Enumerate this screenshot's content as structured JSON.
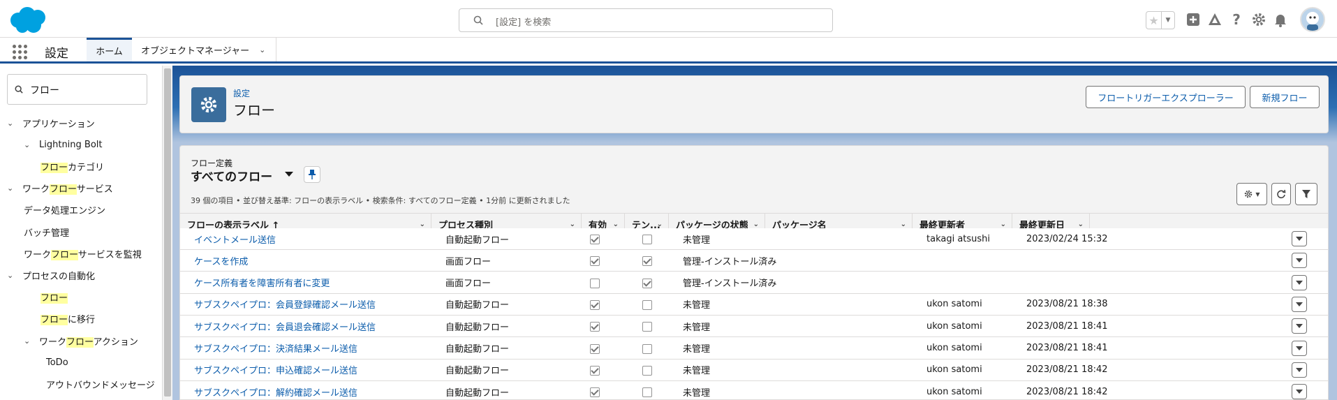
{
  "topbar": {
    "search_placeholder": "[設定] を検索",
    "brand_color": "#00a1e0"
  },
  "nav": {
    "app_name": "設定",
    "tabs": [
      {
        "label": "ホーム",
        "active": true
      },
      {
        "label": "オブジェクトマネージャー",
        "active": false
      }
    ]
  },
  "sidebar": {
    "search_value": "フロー",
    "tree": [
      {
        "pre": "アプリケーション",
        "hl": "",
        "post": "",
        "caret": true,
        "level": 0
      },
      {
        "pre": "Lightning Bolt",
        "hl": "",
        "post": "",
        "caret": true,
        "level": 1
      },
      {
        "pre": "",
        "hl": "フロー",
        "post": "カテゴリ",
        "caret": false,
        "level": 2
      },
      {
        "pre": "ワーク",
        "hl": "フロー",
        "post": "サービス",
        "caret": true,
        "level": 0
      },
      {
        "pre": "データ処理エンジン",
        "hl": "",
        "post": "",
        "caret": false,
        "level": 1
      },
      {
        "pre": "バッチ管理",
        "hl": "",
        "post": "",
        "caret": false,
        "level": 1
      },
      {
        "pre": "ワーク",
        "hl": "フロー",
        "post": "サービスを監視",
        "caret": false,
        "level": 1
      },
      {
        "pre": "プロセスの自動化",
        "hl": "",
        "post": "",
        "caret": true,
        "level": 0
      },
      {
        "pre": "",
        "hl": "フロー",
        "post": "",
        "caret": false,
        "level": 2
      },
      {
        "pre": "",
        "hl": "フロー",
        "post": "に移行",
        "caret": false,
        "level": 2
      },
      {
        "pre": "ワーク",
        "hl": "フロー",
        "post": "アクション",
        "caret": true,
        "level": 1
      },
      {
        "pre": "ToDo",
        "hl": "",
        "post": "",
        "caret": false,
        "level": 3
      },
      {
        "pre": "アウトバウンドメッセージ",
        "hl": "",
        "post": "",
        "caret": false,
        "level": 3
      }
    ]
  },
  "header": {
    "breadcrumb": "設定",
    "title": "フロー",
    "btn_trigger_explorer": "フロートリガーエクスプローラー",
    "btn_new_flow": "新規フロー"
  },
  "listview": {
    "object_label": "フロー定義",
    "name": "すべてのフロー",
    "meta": "39 個の項目 • 並び替え基準: フローの表示ラベル • 検索条件: すべてのフロー定義 • 1分前 に更新されました"
  },
  "table": {
    "columns": [
      "フローの表示ラベル ↑",
      "プロセス種別",
      "有効",
      "テン...",
      "パッケージの状態",
      "パッケージ名",
      "最終更新者",
      "最終更新日"
    ],
    "rows": [
      {
        "label": "イベントメール送信",
        "type": "自動起動フロー",
        "active": true,
        "template": false,
        "pkg_state": "未管理",
        "pkg_name": "",
        "updated_by": "takagi atsushi",
        "updated_at": "2023/02/24 15:32"
      },
      {
        "label": "ケースを作成",
        "type": "画面フロー",
        "active": true,
        "template": true,
        "pkg_state": "管理-インストール済み",
        "pkg_name": "",
        "updated_by": "",
        "updated_at": ""
      },
      {
        "label": "ケース所有者を障害所有者に変更",
        "type": "画面フロー",
        "active": false,
        "template": true,
        "pkg_state": "管理-インストール済み",
        "pkg_name": "",
        "updated_by": "",
        "updated_at": ""
      },
      {
        "label": "サブスクペイプロ：会員登録確認メール送信",
        "type": "自動起動フロー",
        "active": true,
        "template": false,
        "pkg_state": "未管理",
        "pkg_name": "",
        "updated_by": "ukon satomi",
        "updated_at": "2023/08/21 18:38"
      },
      {
        "label": "サブスクペイプロ：会員退会確認メール送信",
        "type": "自動起動フロー",
        "active": true,
        "template": false,
        "pkg_state": "未管理",
        "pkg_name": "",
        "updated_by": "ukon satomi",
        "updated_at": "2023/08/21 18:41"
      },
      {
        "label": "サブスクペイプロ：決済結果メール送信",
        "type": "自動起動フロー",
        "active": true,
        "template": false,
        "pkg_state": "未管理",
        "pkg_name": "",
        "updated_by": "ukon satomi",
        "updated_at": "2023/08/21 18:41"
      },
      {
        "label": "サブスクペイプロ：申込確認メール送信",
        "type": "自動起動フロー",
        "active": true,
        "template": false,
        "pkg_state": "未管理",
        "pkg_name": "",
        "updated_by": "ukon satomi",
        "updated_at": "2023/08/21 18:42"
      },
      {
        "label": "サブスクペイプロ：解約確認メール送信",
        "type": "自動起動フロー",
        "active": true,
        "template": false,
        "pkg_state": "未管理",
        "pkg_name": "",
        "updated_by": "ukon satomi",
        "updated_at": "2023/08/21 18:42"
      }
    ]
  }
}
